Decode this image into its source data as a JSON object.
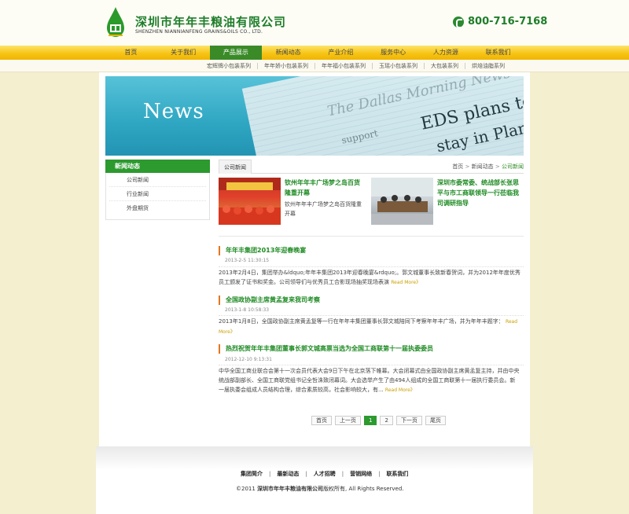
{
  "header": {
    "company_cn": "深圳市年年丰粮油有限公司",
    "company_en": "SHENZHEN NIANNIANFENG GRAINS&OILS CO., LTD.",
    "phone": "800-716-7168"
  },
  "nav": {
    "items": [
      "首页",
      "关于我们",
      "产品展示",
      "新闻动态",
      "产业介绍",
      "服务中心",
      "人力资源",
      "联系我们"
    ],
    "active_index": 2
  },
  "subnav": {
    "items": [
      "宏辉牌小包装系列",
      "年年娇小包装系列",
      "年年福小包装系列",
      "玉瑶小包装系列",
      "大包装系列",
      "烘焙油脂系列"
    ]
  },
  "banner": {
    "title": "News",
    "masthead": "The Dallas Morning News",
    "headline1": "EDS plans to",
    "headline2": "stay in Plano",
    "small": "support"
  },
  "sidebar": {
    "title": "新闻动态",
    "items": [
      "公司新闻",
      "行业新闻",
      "外盘期货"
    ]
  },
  "content": {
    "tab": "公司新闻",
    "breadcrumb": [
      "首页",
      "新闻动态",
      "公司新闻"
    ],
    "breadcrumb_sep": ">"
  },
  "featured": [
    {
      "title": "钦州年年丰广场梦之岛百货隆重开幕",
      "desc": "钦州年年丰广场梦之岛百货隆重开幕"
    },
    {
      "title": "深圳市委常委、统战部长张思平与市工商联领导一行莅临我司调研指导",
      "desc": ""
    }
  ],
  "articles": [
    {
      "title": "年年丰集团2013年迎春晚宴",
      "date": "2013-2-5 11:30:15",
      "body": "2013年2月4日，集团举办&ldquo;年年丰集团2013年迎春晚宴&rdquo;。郭文城董事长致新春贺词，并为2012年年度优秀员工颁发了证书和奖金。公司领导们与优秀员工合影现场抽奖现场表演",
      "more": "Read More》"
    },
    {
      "title": "全国政协副主席黄孟复来我司考察",
      "date": "2013-1-8 10:58:33",
      "body": "2013年1月8日，全国政协副主席黄孟复等一行在年年丰集团董事长郭文城陪同下考察年年丰广场，并为年年丰题字：",
      "more": "Read More》"
    },
    {
      "title": "热烈祝贺年年丰集团董事长郭文城高票当选为全国工商联第十一届执委委员",
      "date": "2012-12-10 9:13:31",
      "body": "中华全国工商业联合会第十一次会员代表大会9日下午在北京落下帷幕。大会闭幕式由全国政协副主席黄孟复主持，并由中央统战部副部长、全国工商联党组书记全哲洙致闭幕词。大会选举产生了由494人组成的全国工商联第十一届执行委员会。新一届执委会组成人员结构合理，综合素质较高，社会影响较大，有...",
      "more": "Read More》"
    }
  ],
  "pagination": {
    "first": "首页",
    "prev": "上一页",
    "pages": [
      "1",
      "2"
    ],
    "current": "1",
    "next": "下一页",
    "last": "尾页"
  },
  "footer": {
    "links": [
      "集团简介",
      "最新动态",
      "人才招聘",
      "营销网络",
      "联系我们"
    ],
    "separator": "|",
    "copyright_prefix": "©2011",
    "copyright_company": "深圳市年年丰粮油有限公司",
    "copyright_suffix": "版权所有, All Rights Reserved."
  },
  "colors": {
    "brand_green": "#1e7d2a",
    "nav_yellow": "#f7c416",
    "accent_orange": "#e5761d"
  }
}
